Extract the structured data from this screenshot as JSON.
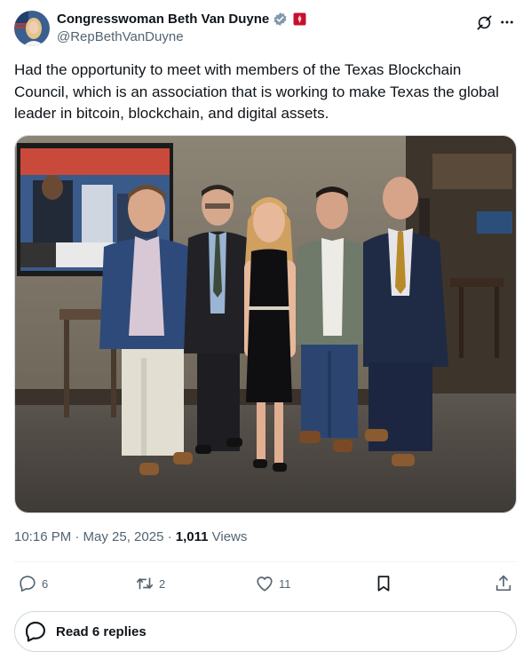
{
  "author": {
    "display_name": "Congresswoman Beth Van Duyne",
    "handle": "@RepBethVanDuyne",
    "verified_color": "#829aab",
    "affiliation_color": "#c8102e"
  },
  "tweet": {
    "text": "Had the opportunity to meet with members of the Texas Blockchain Council, which is an association that is working to make Texas the global leader in bitcoin, blockchain, and digital assets.",
    "photo_alt": "Group photo of five people in a restaurant"
  },
  "meta": {
    "timestamp": "10:16 PM · May 25, 2025 · ",
    "views_count": "1,011",
    "views_label": " Views"
  },
  "actions": {
    "reply_count": "6",
    "retweet_count": "2",
    "like_count": "11"
  },
  "footer": {
    "read_replies_label": "Read 6 replies"
  },
  "icons": {
    "reply": "reply-icon",
    "retweet": "retweet-icon",
    "like": "heart-icon",
    "bookmark": "bookmark-icon",
    "share": "share-icon",
    "grok": "grok-icon",
    "more": "more-icon"
  },
  "colors": {
    "text_primary": "#0f1419",
    "text_secondary": "#536471",
    "border": "#cfd9de"
  }
}
